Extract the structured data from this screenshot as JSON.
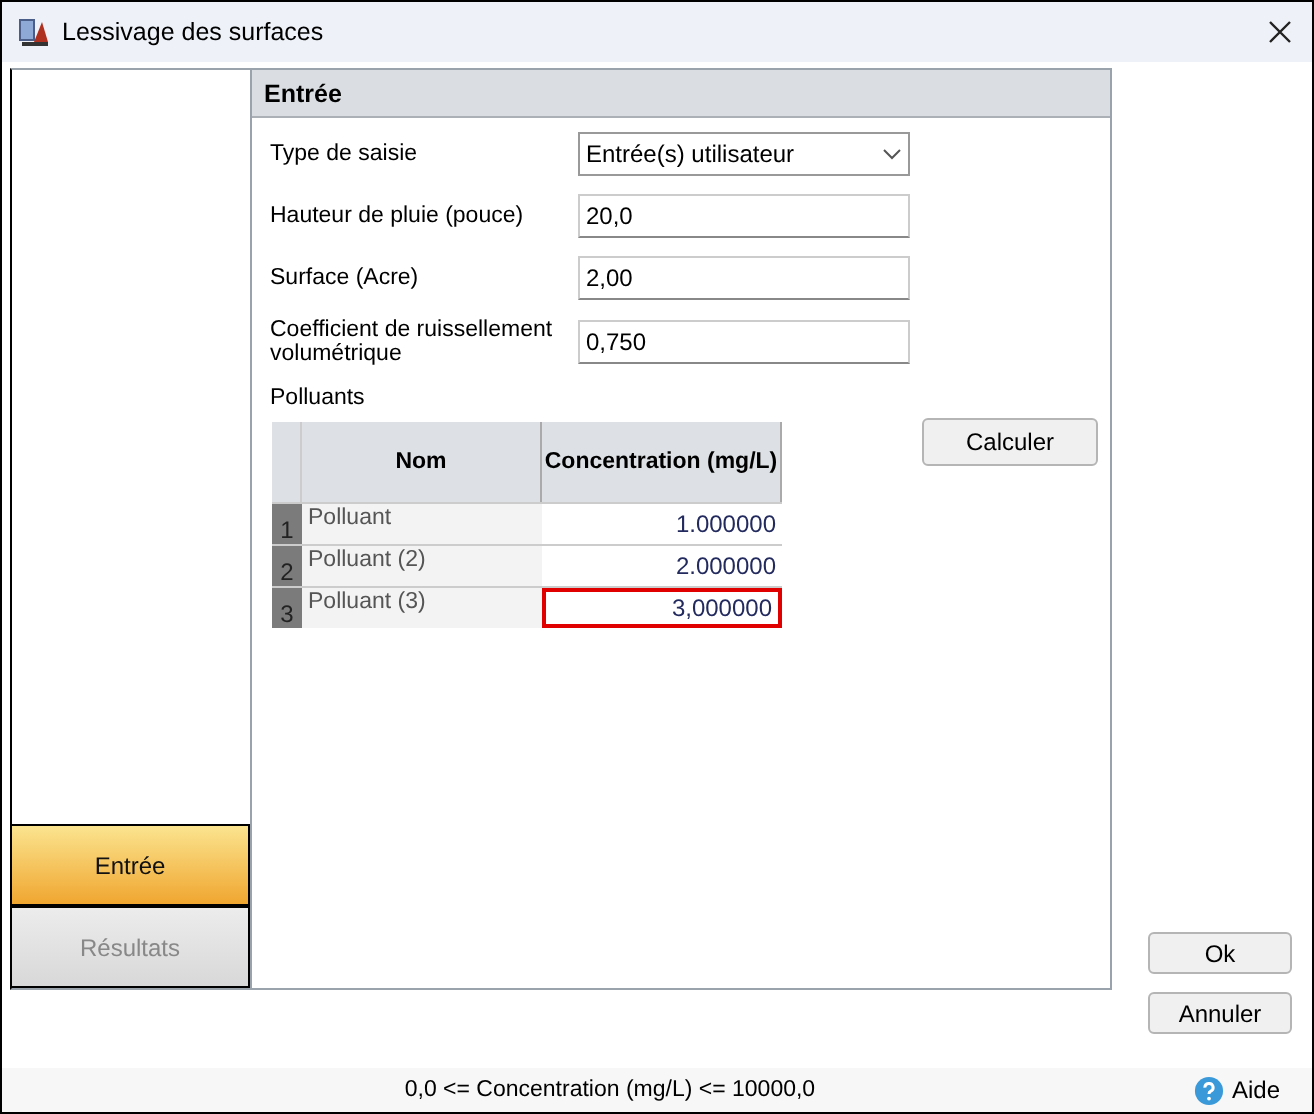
{
  "window": {
    "title": "Lessivage des surfaces"
  },
  "nav": [
    {
      "label": "Entrée",
      "selected": true
    },
    {
      "label": "Résultats",
      "selected": false
    }
  ],
  "section": {
    "title": "Entrée"
  },
  "fields": [
    {
      "kind": "dropdown",
      "label": "Type de saisie",
      "value": "Entrée(s) utilisateur"
    },
    {
      "kind": "text",
      "label": "Hauteur de pluie (pouce)",
      "value": "20,0"
    },
    {
      "kind": "text",
      "label": "Surface (Acre)",
      "value": "2,00"
    },
    {
      "kind": "text",
      "label": "Coefficient de ruissellement volumétrique",
      "value": "0,750"
    }
  ],
  "pollutants": {
    "label": "Polluants",
    "columns": [
      "Nom",
      "Concentration (mg/L)"
    ],
    "rows": [
      {
        "index": "1",
        "name": "Polluant",
        "concentration": "1.000000",
        "invalid": false
      },
      {
        "index": "2",
        "name": "Polluant (2)",
        "concentration": "2.000000",
        "invalid": false
      },
      {
        "index": "3",
        "name": "Polluant (3)",
        "concentration": "3,000000",
        "invalid": true
      }
    ]
  },
  "calculate_button": "Calculer",
  "buttons": [
    "Ok",
    "Annuler"
  ],
  "status_bar": {
    "message": "0,0 <= Concentration (mg/L) <= 10000,0",
    "help": "Aide"
  }
}
